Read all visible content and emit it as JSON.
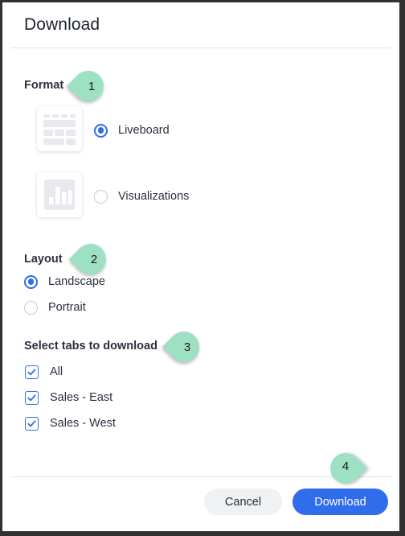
{
  "dialog": {
    "title": "Download"
  },
  "sections": {
    "format": {
      "label": "Format",
      "badge": "1",
      "options": [
        {
          "label": "Liveboard",
          "icon": "liveboard-grid-icon",
          "selected": "true"
        },
        {
          "label": "Visualizations",
          "icon": "bar-chart-icon",
          "selected": "false"
        }
      ]
    },
    "layout": {
      "label": "Layout",
      "badge": "2",
      "options": [
        {
          "label": "Landscape",
          "selected": "true"
        },
        {
          "label": "Portrait",
          "selected": "false"
        }
      ]
    },
    "tabs": {
      "label": "Select tabs to download",
      "badge": "3",
      "options": [
        {
          "label": "All",
          "checked": "true"
        },
        {
          "label": "Sales - East",
          "checked": "true"
        },
        {
          "label": "Sales - West",
          "checked": "true"
        }
      ]
    }
  },
  "footer": {
    "badge": "4",
    "cancel_label": "Cancel",
    "download_label": "Download"
  },
  "colors": {
    "accent_blue": "#2f6ded",
    "badge_green": "#9de0c3",
    "text_dark": "#2b3041",
    "title_dark": "#1d2330",
    "cancel_gray": "#f0f1f3"
  }
}
